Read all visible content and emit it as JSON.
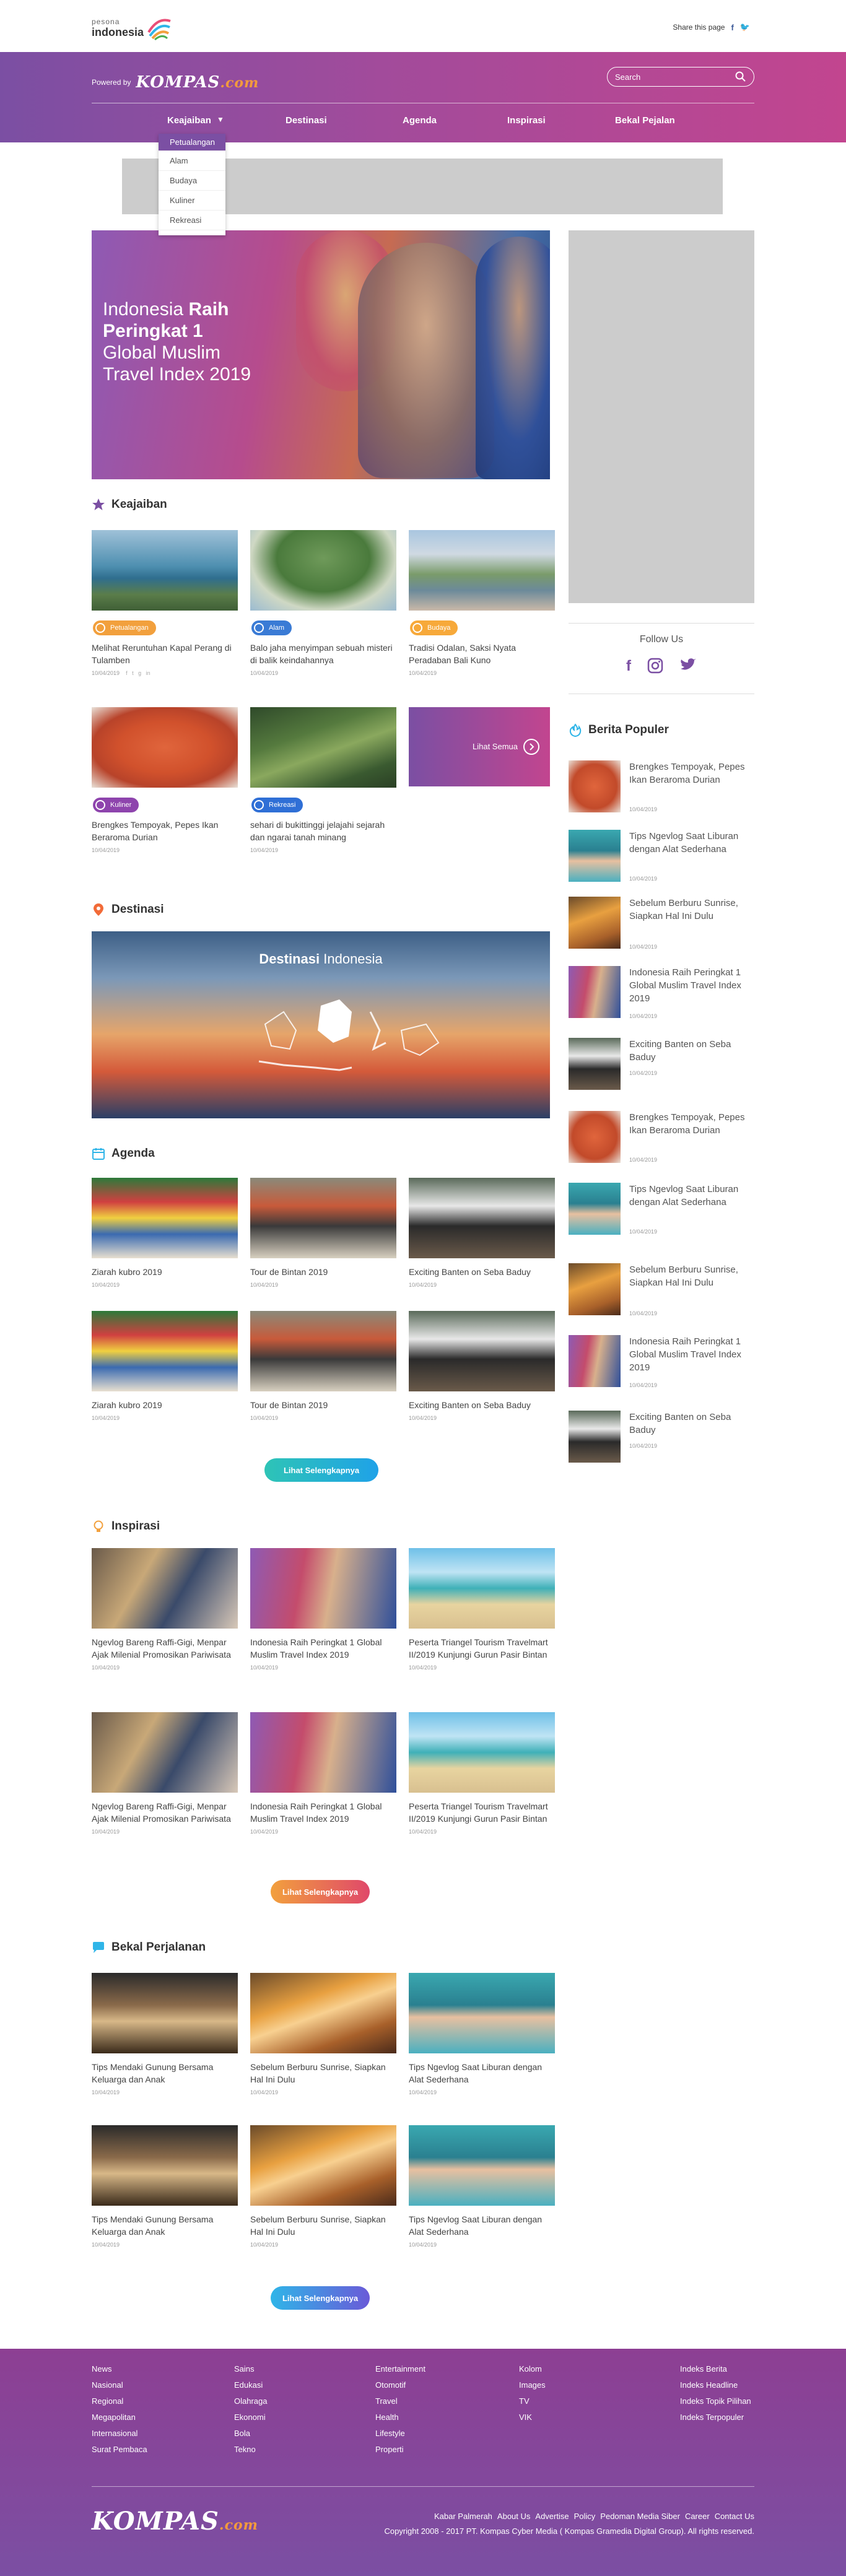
{
  "topbar": {
    "logo_small": "pesona",
    "logo_big": "indonesia",
    "share_label": "Share this page"
  },
  "header": {
    "powered_by": "Powered by",
    "brand": "KOMPAS",
    "brand_suffix": ".com",
    "search_placeholder": "Search",
    "nav": [
      "Keajaiban",
      "Destinasi",
      "Agenda",
      "Inspirasi",
      "Bekal Pejalan"
    ],
    "dropdown": [
      "Petualangan",
      "Alam",
      "Budaya",
      "Kuliner",
      "Rekreasi"
    ]
  },
  "hero": {
    "title_pre": "Indonesia ",
    "title_bold": "Raih Peringkat 1",
    "title_post": " Global Muslim Travel Index 2019"
  },
  "keajaiban": {
    "heading": "Keajaiban",
    "cards": [
      {
        "badge": "Petualangan",
        "title": "Melihat Reruntuhan Kapal Perang di Tulamben",
        "date": "10/04/2019"
      },
      {
        "badge": "Alam",
        "title": "Balo jaha menyimpan sebuah misteri di balik keindahannya",
        "date": "10/04/2019"
      },
      {
        "badge": "Budaya",
        "title": "Tradisi Odalan, Saksi Nyata Peradaban Bali Kuno",
        "date": "10/04/2019"
      },
      {
        "badge": "Kuliner",
        "title": "Brengkes Tempoyak, Pepes Ikan Beraroma Durian",
        "date": "10/04/2019"
      },
      {
        "badge": "Rekreasi",
        "title": "sehari di bukittinggi jelajahi sejarah dan ngarai tanah minang",
        "date": "10/04/2019"
      }
    ],
    "lihat_semua": "Lihat Semua"
  },
  "destinasi": {
    "heading": "Destinasi",
    "banner_bold": "Destinasi",
    "banner_rest": " Indonesia"
  },
  "agenda": {
    "heading": "Agenda",
    "cards": [
      {
        "title": "Ziarah kubro 2019",
        "date": "10/04/2019"
      },
      {
        "title": "Tour de Bintan 2019",
        "date": "10/04/2019"
      },
      {
        "title": "Exciting Banten on Seba Baduy",
        "date": "10/04/2019"
      },
      {
        "title": "Ziarah kubro 2019",
        "date": "10/04/2019"
      },
      {
        "title": "Tour de Bintan 2019",
        "date": "10/04/2019"
      },
      {
        "title": "Exciting Banten on Seba Baduy",
        "date": "10/04/2019"
      }
    ],
    "button": "Lihat Selengkapnya"
  },
  "inspirasi": {
    "heading": "Inspirasi",
    "cards": [
      {
        "title": "Ngevlog Bareng Raffi-Gigi, Menpar Ajak Milenial Promosikan Pariwisata",
        "date": "10/04/2019"
      },
      {
        "title": "Indonesia Raih Peringkat 1 Global Muslim Travel Index 2019",
        "date": "10/04/2019"
      },
      {
        "title": "Peserta Triangel Tourism Travelmart II/2019 Kunjungi Gurun Pasir Bintan",
        "date": "10/04/2019"
      },
      {
        "title": "Ngevlog Bareng Raffi-Gigi, Menpar Ajak Milenial Promosikan Pariwisata",
        "date": "10/04/2019"
      },
      {
        "title": "Indonesia Raih Peringkat 1 Global Muslim Travel Index 2019",
        "date": "10/04/2019"
      },
      {
        "title": "Peserta Triangel Tourism Travelmart II/2019 Kunjungi Gurun Pasir Bintan",
        "date": "10/04/2019"
      }
    ],
    "button": "Lihat Selengkapnya"
  },
  "bekal": {
    "heading": "Bekal Perjalanan",
    "cards": [
      {
        "title": "Tips Mendaki Gunung Bersama Keluarga dan Anak",
        "date": "10/04/2019"
      },
      {
        "title": "Sebelum Berburu Sunrise, Siapkan Hal Ini Dulu",
        "date": "10/04/2019"
      },
      {
        "title": "Tips Ngevlog Saat Liburan dengan Alat Sederhana",
        "date": "10/04/2019"
      },
      {
        "title": "Tips Mendaki Gunung Bersama Keluarga dan Anak",
        "date": "10/04/2019"
      },
      {
        "title": "Sebelum Berburu Sunrise, Siapkan Hal Ini Dulu",
        "date": "10/04/2019"
      },
      {
        "title": "Tips Ngevlog Saat Liburan dengan Alat Sederhana",
        "date": "10/04/2019"
      }
    ],
    "button": "Lihat Selengkapnya"
  },
  "sidebar": {
    "follow_us": "Follow Us",
    "popular_heading": "Berita Populer",
    "popular": [
      {
        "title": "Brengkes Tempoyak, Pepes Ikan Beraroma Durian",
        "date": "10/04/2019"
      },
      {
        "title": "Tips Ngevlog Saat Liburan dengan Alat Sederhana",
        "date": "10/04/2019"
      },
      {
        "title": "Sebelum Berburu Sunrise, Siapkan Hal Ini Dulu",
        "date": "10/04/2019"
      },
      {
        "title": "Indonesia Raih Peringkat 1 Global Muslim Travel Index 2019",
        "date": "10/04/2019"
      },
      {
        "title": "Exciting Banten on Seba Baduy",
        "date": "10/04/2019"
      },
      {
        "title": "Brengkes Tempoyak, Pepes Ikan Beraroma Durian",
        "date": "10/04/2019"
      },
      {
        "title": "Tips Ngevlog Saat Liburan dengan Alat Sederhana",
        "date": "10/04/2019"
      },
      {
        "title": "Sebelum Berburu Sunrise, Siapkan Hal Ini Dulu",
        "date": "10/04/2019"
      },
      {
        "title": "Indonesia Raih Peringkat 1 Global Muslim Travel Index 2019",
        "date": "10/04/2019"
      },
      {
        "title": "Exciting Banten on Seba Baduy",
        "date": "10/04/2019"
      }
    ]
  },
  "footer": {
    "col1": [
      "News",
      "Nasional",
      "Regional",
      "Megapolitan",
      "Internasional",
      "Surat Pembaca"
    ],
    "col2": [
      "Sains",
      "Edukasi",
      "Olahraga",
      "Ekonomi",
      "Bola",
      "Tekno"
    ],
    "col3": [
      "Entertainment",
      "Otomotif",
      "Travel",
      "Health",
      "Lifestyle",
      "Properti"
    ],
    "col4": [
      "Kolom",
      "Images",
      "TV",
      "VIK"
    ],
    "col5": [
      "Indeks Berita",
      "Indeks Headline",
      "Indeks Topik Pilihan",
      "Indeks Terpopuler"
    ],
    "bottom_links": [
      "Kabar Palmerah",
      "About Us",
      "Advertise",
      "Policy",
      "Pedoman Media Siber",
      "Career",
      "Contact Us"
    ],
    "copyright": "Copyright 2008 - 2017 PT. Kompas Cyber Media ( Kompas Gramedia Digital Group). All rights reserved.",
    "brand": "KOMPAS",
    "brand_suffix": ".com"
  },
  "colors": {
    "purple": "#7b4fa3",
    "magenta": "#c2458f",
    "badge_petualangan": "#f2a03d",
    "badge_alam": "#3a7bd5",
    "badge_budaya": "#f7a93a",
    "badge_kuliner": "#8e44ad",
    "badge_rekreasi": "#2f6fd6"
  }
}
